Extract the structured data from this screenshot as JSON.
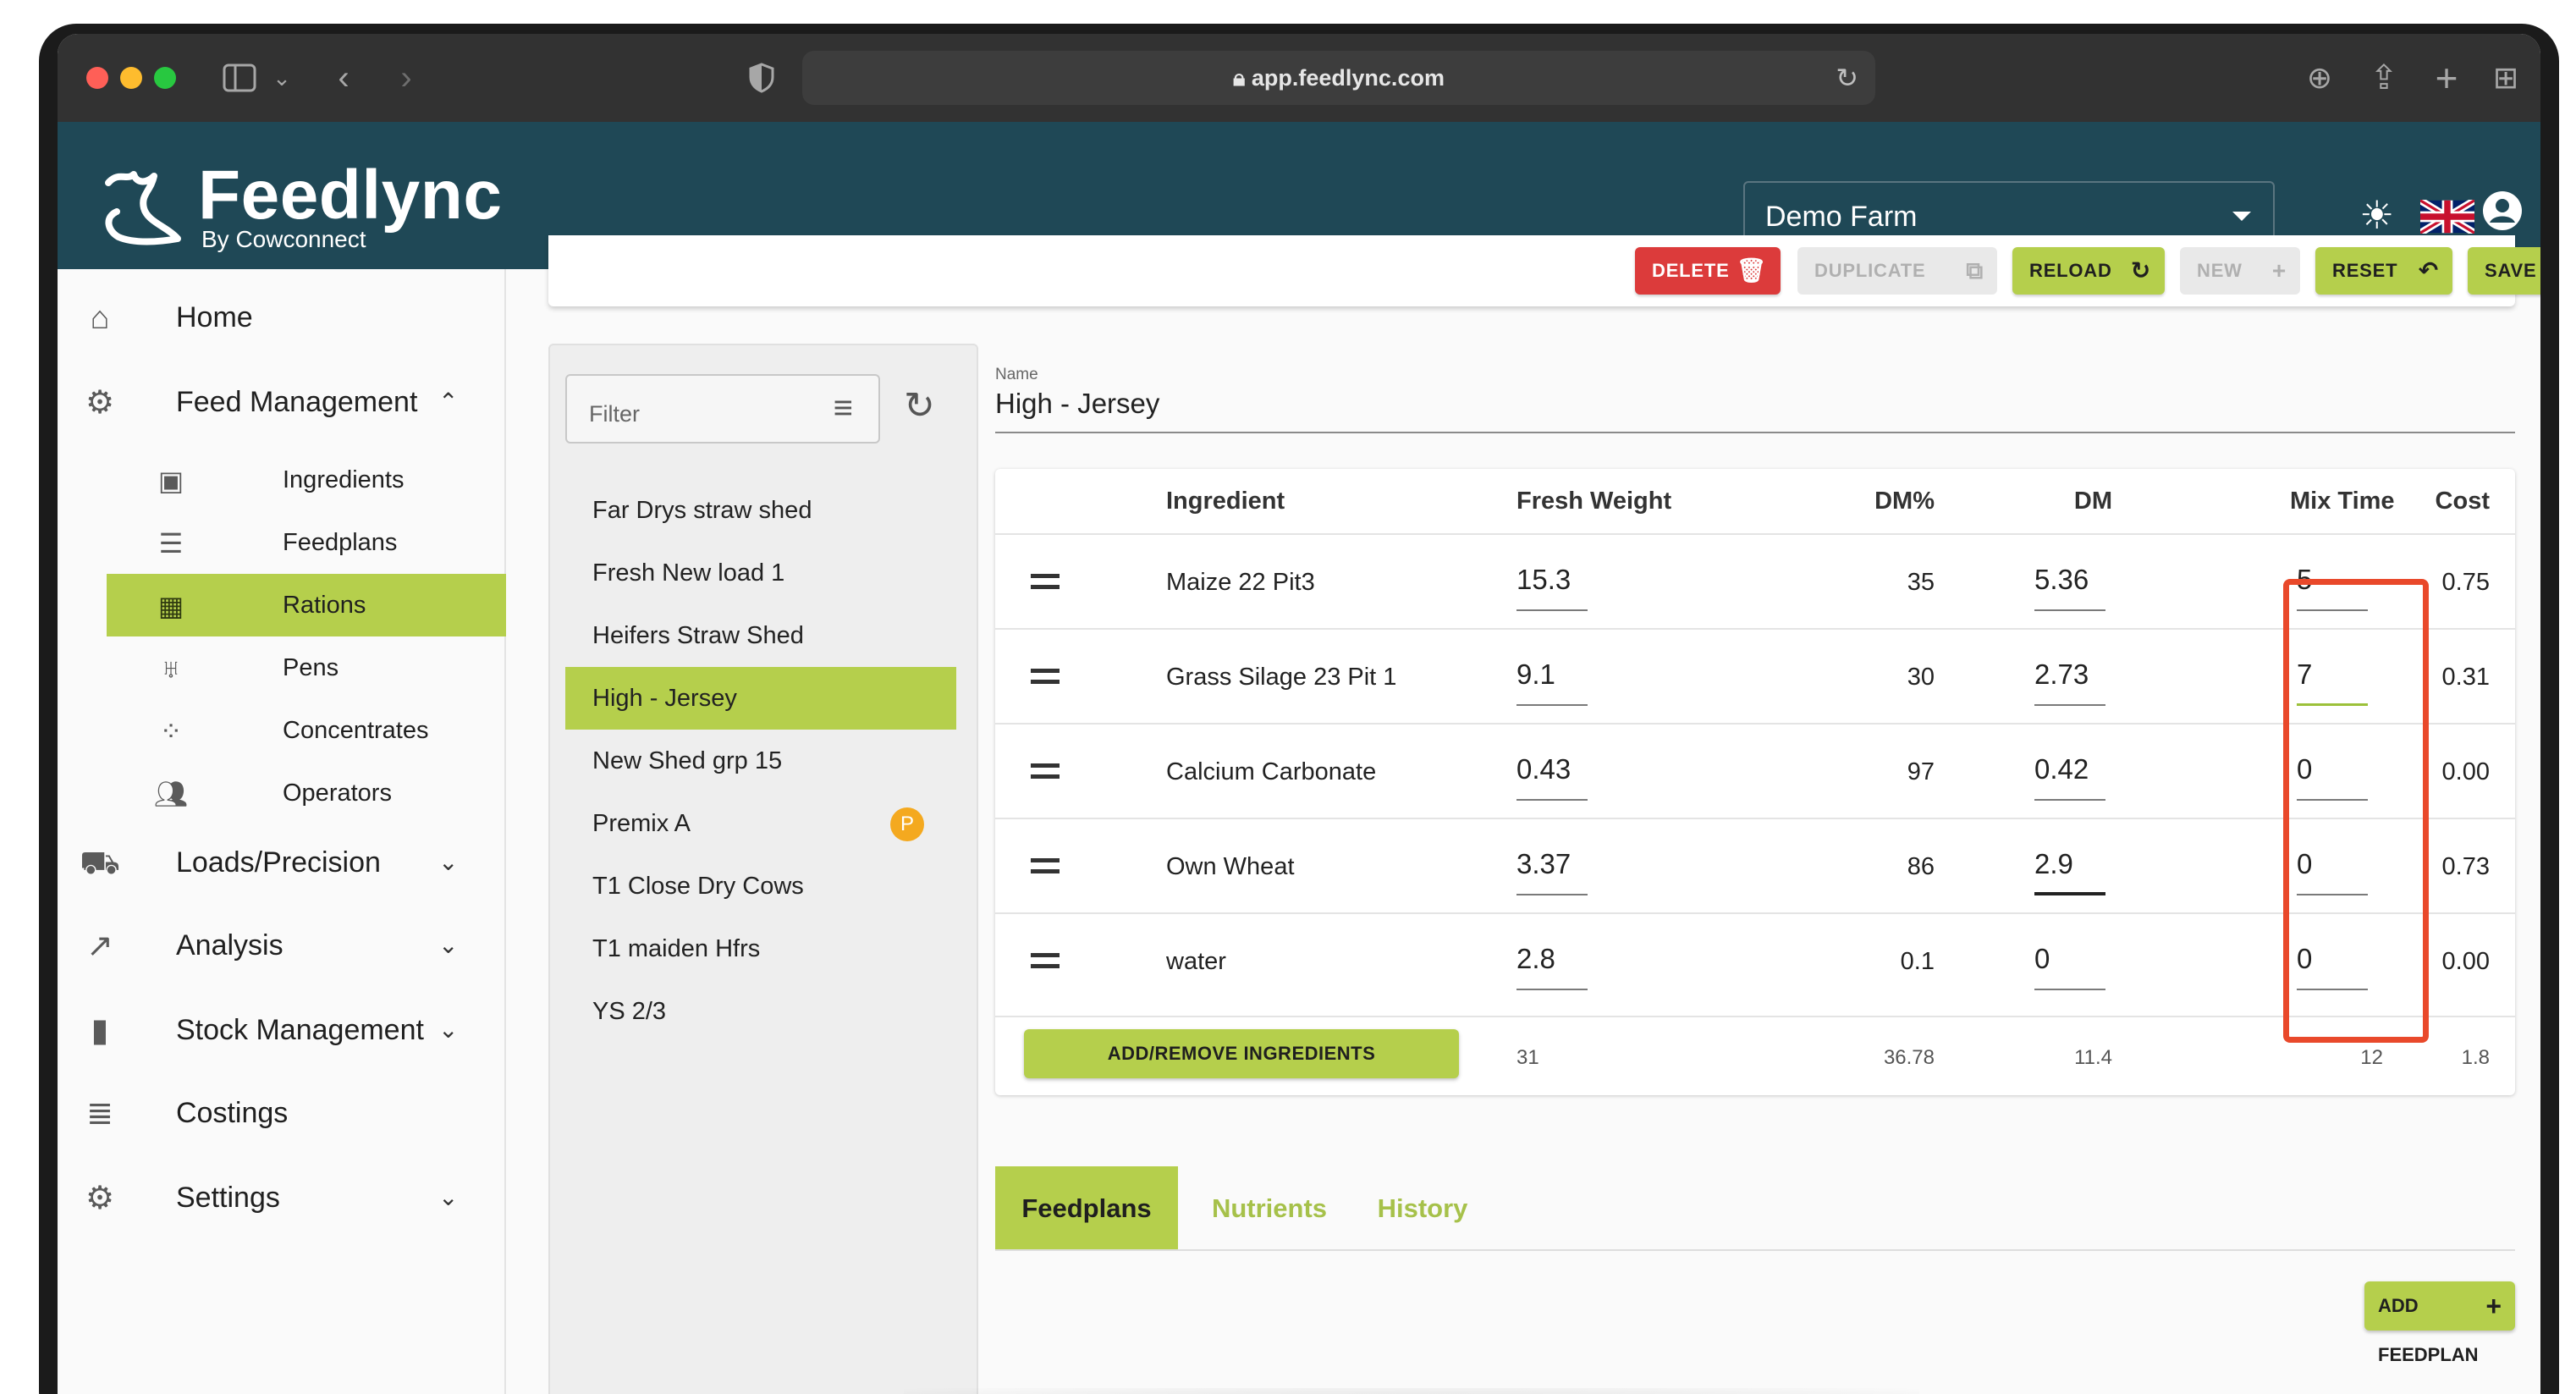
{
  "browser": {
    "url": "app.feedlync.com"
  },
  "app": {
    "logo_title": "Feedlync",
    "logo_subtitle": "By Cowconnect",
    "farm_select": "Demo Farm",
    "accent_color": "#b5cf4c",
    "header_color": "#1f4856",
    "danger_color": "#dc3b3b"
  },
  "sidebar": {
    "items": [
      {
        "label": "Home",
        "icon": "home-icon"
      },
      {
        "label": "Feed Management",
        "icon": "feed-management-icon",
        "expanded": true
      },
      {
        "label": "Loads/Precision",
        "icon": "wagon-icon"
      },
      {
        "label": "Analysis",
        "icon": "trend-icon"
      },
      {
        "label": "Stock Management",
        "icon": "bookmark-icon"
      },
      {
        "label": "Costings",
        "icon": "costings-icon"
      },
      {
        "label": "Settings",
        "icon": "gear-icon"
      }
    ],
    "sub_items": [
      {
        "label": "Ingredients",
        "icon": "sack-icon"
      },
      {
        "label": "Feedplans",
        "icon": "checklist-icon"
      },
      {
        "label": "Rations",
        "icon": "ration-book-icon",
        "active": true
      },
      {
        "label": "Pens",
        "icon": "pen-icon"
      },
      {
        "label": "Concentrates",
        "icon": "dots-icon"
      },
      {
        "label": "Operators",
        "icon": "people-icon"
      }
    ]
  },
  "toolbar": {
    "delete": "DELETE",
    "duplicate": "DUPLICATE",
    "reload": "RELOAD",
    "new": "NEW",
    "reset": "RESET",
    "save": "SAVE"
  },
  "rations": {
    "filter_placeholder": "Filter",
    "items": [
      {
        "label": "Far Drys straw shed"
      },
      {
        "label": "Fresh New load 1"
      },
      {
        "label": "Heifers Straw Shed"
      },
      {
        "label": "High - Jersey",
        "active": true
      },
      {
        "label": "New Shed grp 15"
      },
      {
        "label": "Premix A",
        "badge": "P"
      },
      {
        "label": "T1 Close Dry Cows"
      },
      {
        "label": "T1 maiden Hfrs"
      },
      {
        "label": "YS 2/3"
      }
    ]
  },
  "form": {
    "name_label": "Name",
    "name_value": "High - Jersey"
  },
  "table": {
    "headers": {
      "ingredient": "Ingredient",
      "fresh_weight": "Fresh Weight",
      "dm_pct": "DM%",
      "dm": "DM",
      "mix_time": "Mix Time",
      "cost": "Cost"
    },
    "rows": [
      {
        "ingredient": "Maize 22 Pit3",
        "fresh_weight": "15.3",
        "dm_pct": "35",
        "dm": "5.36",
        "mix_time": "5",
        "cost": "0.75"
      },
      {
        "ingredient": "Grass Silage 23 Pit 1",
        "fresh_weight": "9.1",
        "dm_pct": "30",
        "dm": "2.73",
        "mix_time": "7",
        "cost": "0.31"
      },
      {
        "ingredient": "Calcium Carbonate",
        "fresh_weight": "0.43",
        "dm_pct": "97",
        "dm": "0.42",
        "mix_time": "0",
        "cost": "0.00"
      },
      {
        "ingredient": "Own Wheat",
        "fresh_weight": "3.37",
        "dm_pct": "86",
        "dm": "2.9",
        "mix_time": "0",
        "cost": "0.73"
      },
      {
        "ingredient": "water",
        "fresh_weight": "2.8",
        "dm_pct": "0.1",
        "dm": "0",
        "mix_time": "0",
        "cost": "0.00"
      }
    ],
    "add_remove": "ADD/REMOVE INGREDIENTS",
    "totals": {
      "fresh_weight": "31",
      "dm_pct": "36.78",
      "dm": "11.4",
      "mix_time": "12",
      "cost": "1.8"
    }
  },
  "tabs": [
    {
      "label": "Feedplans",
      "active": true
    },
    {
      "label": "Nutrients"
    },
    {
      "label": "History"
    }
  ],
  "add_feedplan": "ADD FEEDPLAN"
}
